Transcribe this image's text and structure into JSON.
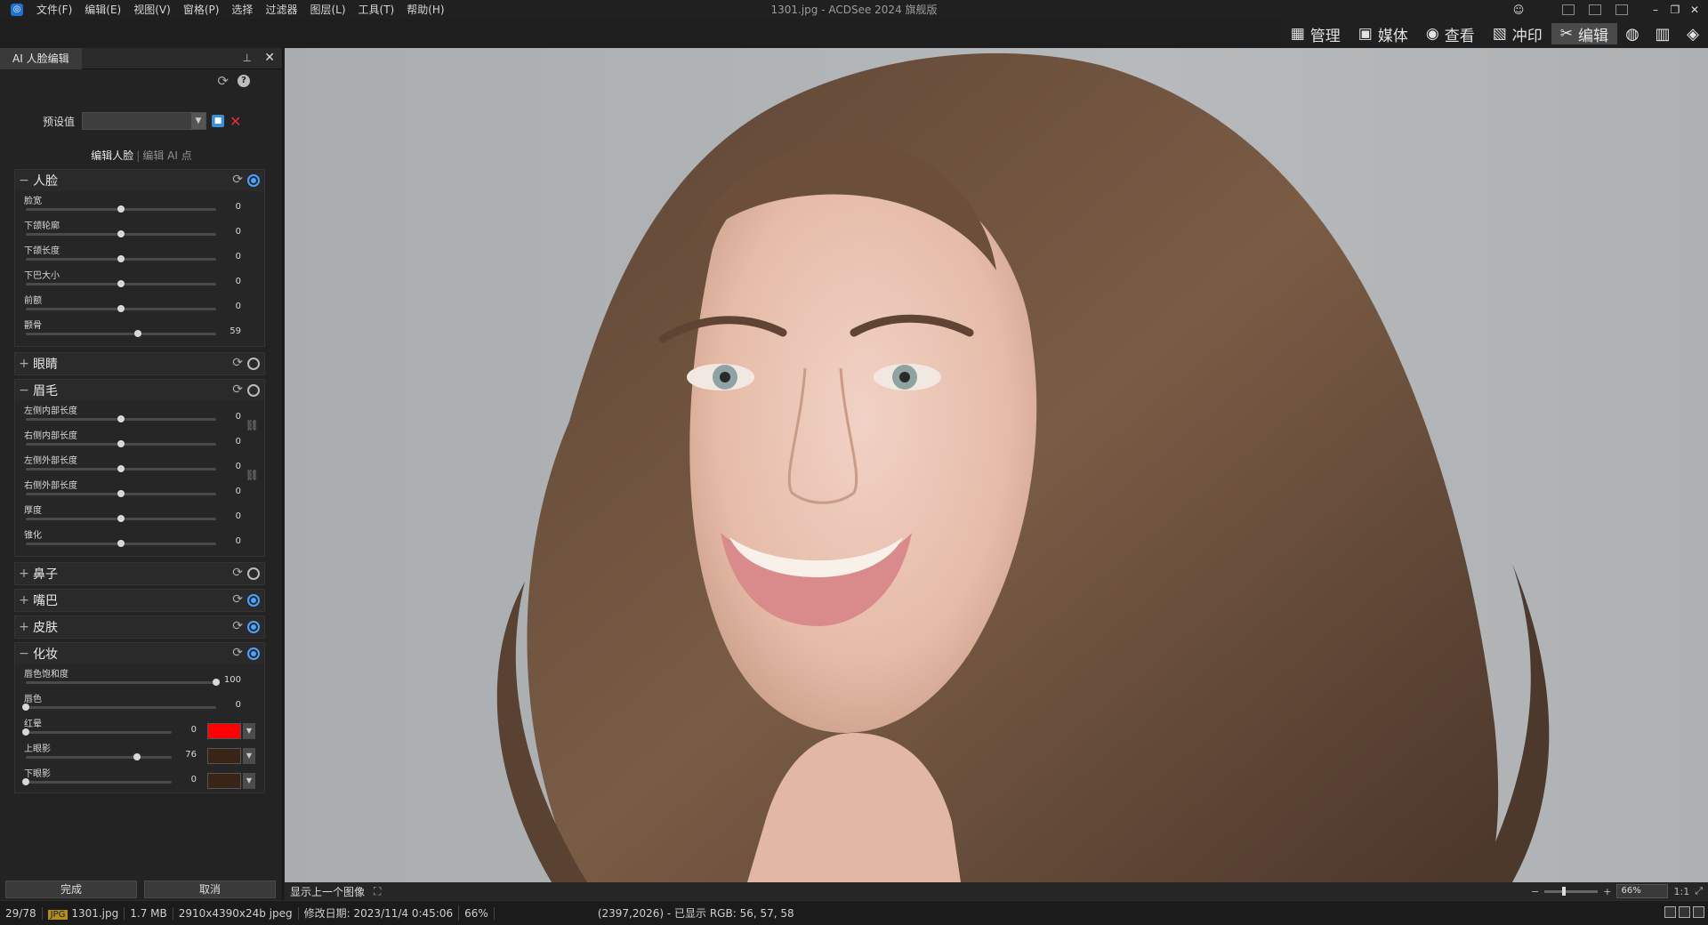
{
  "window": {
    "title": "1301.jpg - ACDSee 2024 旗舰版",
    "menu": [
      "文件(F)",
      "编辑(E)",
      "视图(V)",
      "窗格(P)",
      "选择",
      "过滤器",
      "图层(L)",
      "工具(T)",
      "帮助(H)"
    ]
  },
  "modes": [
    {
      "label": "管理",
      "icon": "grid-icon"
    },
    {
      "label": "媒体",
      "icon": "media-icon"
    },
    {
      "label": "查看",
      "icon": "eye-icon"
    },
    {
      "label": "冲印",
      "icon": "develop-icon"
    },
    {
      "label": "编辑",
      "icon": "edit-icon",
      "active": true
    }
  ],
  "panel": {
    "tab_title": "AI 人脸编辑",
    "preset_label": "预设值",
    "preset_value": "",
    "edit_tab_face": "编辑人脸",
    "edit_tab_ai": "编辑 AI 点",
    "done": "完成",
    "cancel": "取消",
    "sections": {
      "face": {
        "title": "人脸",
        "expanded": true,
        "enabled": true,
        "sliders": [
          {
            "label": "脸宽",
            "value": "0",
            "fraction": 0.5
          },
          {
            "label": "下颌轮廓",
            "value": "0",
            "fraction": 0.5
          },
          {
            "label": "下颌长度",
            "value": "0",
            "fraction": 0.5
          },
          {
            "label": "下巴大小",
            "value": "0",
            "fraction": 0.5
          },
          {
            "label": "前额",
            "value": "0",
            "fraction": 0.5
          },
          {
            "label": "颧骨",
            "value": "59",
            "fraction": 0.59
          }
        ]
      },
      "eyes": {
        "title": "眼睛",
        "expanded": false,
        "enabled": false
      },
      "eyebrows": {
        "title": "眉毛",
        "expanded": true,
        "enabled": false,
        "sliders": [
          {
            "label": "左侧内部长度",
            "value": "0",
            "fraction": 0.5
          },
          {
            "label": "右侧内部长度",
            "value": "0",
            "fraction": 0.5
          },
          {
            "label": "左侧外部长度",
            "value": "0",
            "fraction": 0.5
          },
          {
            "label": "右侧外部长度",
            "value": "0",
            "fraction": 0.5
          },
          {
            "label": "厚度",
            "value": "0",
            "fraction": 0.5
          },
          {
            "label": "锥化",
            "value": "0",
            "fraction": 0.5
          }
        ]
      },
      "nose": {
        "title": "鼻子",
        "expanded": false,
        "enabled": false
      },
      "mouth": {
        "title": "嘴巴",
        "expanded": false,
        "enabled": true
      },
      "skin": {
        "title": "皮肤",
        "expanded": false,
        "enabled": true
      },
      "makeup": {
        "title": "化妆",
        "expanded": true,
        "enabled": true,
        "sliders": [
          {
            "label": "唇色饱和度",
            "value": "100",
            "fraction": 1.0
          },
          {
            "label": "唇色",
            "value": "0",
            "fraction": 0.0
          },
          {
            "label": "红晕",
            "value": "0",
            "fraction": 0.0,
            "color": "#ff0000"
          },
          {
            "label": "上眼影",
            "value": "76",
            "fraction": 0.76,
            "color": "#3a2418"
          },
          {
            "label": "下眼影",
            "value": "0",
            "fraction": 0.0,
            "color": "#3a2418"
          }
        ]
      }
    }
  },
  "canvas": {
    "prev_image_button": "显示上一个图像",
    "zoom": "66%",
    "zoom_ratio": "1:1"
  },
  "status": {
    "index": "29/78",
    "file_type": "JPG",
    "filename": "1301.jpg",
    "size": "1.7 MB",
    "dimensions": "2910x4390x24b jpeg",
    "modified": "修改日期: 2023/11/4 0:45:06",
    "zoom": "66%",
    "pixel_info": "(2397,2026) - 已显示 RGB: 56, 57, 58"
  },
  "colors": {
    "accent": "#4aa3ff",
    "delete": "#e0303a"
  }
}
